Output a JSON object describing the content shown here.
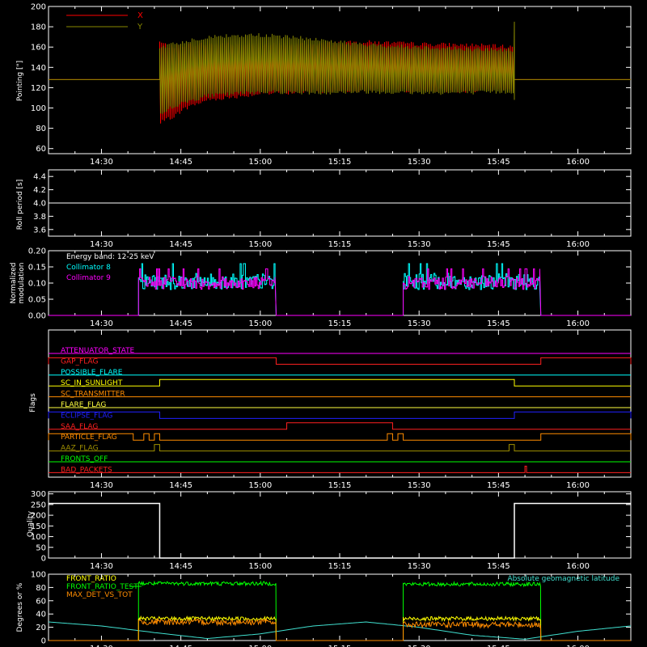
{
  "colors": {
    "background": "#000000",
    "axes": "#ffffff",
    "x_pointing": "#ff0000",
    "y_pointing": "#8a8a00",
    "roll": "#ffffff",
    "collimator8": "#00ffff",
    "collimator9": "#ff00ff",
    "quality": "#ffffff",
    "front_ratio": "#ffff00",
    "front_ratio_test": "#00ff00",
    "max_det": "#ff8c00",
    "geo_lat": "#40e0d0"
  },
  "time_axis": {
    "start_min": 20,
    "end_min": 85,
    "tick_labels": [
      "14:30",
      "14:45",
      "15:00",
      "15:15",
      "15:30",
      "15:45",
      "16:00"
    ],
    "tick_minutes": [
      30,
      45,
      60,
      75,
      90,
      105,
      120
    ],
    "tick_offset_min": [
      25,
      40,
      55,
      70,
      85,
      100,
      115
    ]
  },
  "chart_data": [
    {
      "id": "pointing",
      "type": "line",
      "ylabel": "Pointing [\"]",
      "ylim": [
        55,
        200
      ],
      "yticks": [
        60,
        80,
        100,
        120,
        140,
        160,
        180,
        200
      ],
      "legend": [
        {
          "name": "X",
          "color": "#ff0000"
        },
        {
          "name": "Y",
          "color": "#8a8a00"
        }
      ],
      "series": [
        {
          "name": "X",
          "color": "#ff0000",
          "baseline": 128,
          "active_start": "14:41",
          "active_end": "15:48",
          "env_time": [
            "14:41",
            "14:43",
            "14:46",
            "14:50",
            "15:00",
            "15:10",
            "15:20",
            "15:30",
            "15:40",
            "15:48"
          ],
          "env_low": [
            85,
            90,
            100,
            108,
            114,
            116,
            118,
            117,
            117,
            118
          ],
          "env_high": [
            165,
            160,
            162,
            163,
            162,
            163,
            165,
            163,
            162,
            160
          ]
        },
        {
          "name": "Y",
          "color": "#8a8a00",
          "baseline": 128,
          "active_start": "14:41",
          "active_end": "15:48",
          "env_time": [
            "14:41",
            "14:43",
            "14:46",
            "14:50",
            "15:00",
            "15:10",
            "15:20",
            "15:30",
            "15:40",
            "15:48"
          ],
          "env_low": [
            94,
            100,
            106,
            112,
            116,
            115,
            116,
            115,
            115,
            116
          ],
          "env_high": [
            160,
            162,
            166,
            170,
            172,
            168,
            162,
            160,
            158,
            157
          ]
        }
      ]
    },
    {
      "id": "roll",
      "type": "line",
      "ylabel": "Roll period [s]",
      "ylim": [
        3.5,
        4.5
      ],
      "yticks": [
        3.6,
        3.8,
        4.0,
        4.2,
        4.4
      ],
      "series": [
        {
          "name": "Roll period",
          "constant": 4.0
        }
      ]
    },
    {
      "id": "modulation",
      "type": "line",
      "ylabel": "Normalized modulation",
      "ylim": [
        0,
        0.2
      ],
      "yticks": [
        0.0,
        0.05,
        0.1,
        0.15,
        0.2
      ],
      "ytick_labels": [
        "0.00",
        "0.05",
        "0.10",
        "0.15",
        "0.20"
      ],
      "annotation": "Energy band: 12-25 keV",
      "legend": [
        {
          "name": "Collimator 8",
          "color": "#00ffff"
        },
        {
          "name": "Collimator 9",
          "color": "#ff00ff"
        }
      ],
      "segments": [
        [
          "14:37",
          "15:03"
        ],
        [
          "15:27",
          "15:53"
        ]
      ],
      "series": [
        {
          "name": "Collimator 8",
          "color": "#00ffff",
          "mean": 0.105,
          "spread": 0.025
        },
        {
          "name": "Collimator 9",
          "color": "#ff00ff",
          "mean": 0.1,
          "spread": 0.02
        }
      ]
    },
    {
      "id": "flags",
      "type": "step",
      "ylabel": "Flags",
      "flags": [
        {
          "name": "ATTENUATOR_STATE",
          "color": "#ff00ff",
          "high_intervals": []
        },
        {
          "name": "GAP_FLAG",
          "color": "#ff2020",
          "high_intervals": [
            [
              "14:20",
              "15:03"
            ],
            [
              "15:53",
              "16:10"
            ]
          ]
        },
        {
          "name": "POSSIBLE_FLARE",
          "color": "#00ffff",
          "high_intervals": []
        },
        {
          "name": "SC_IN_SUNLIGHT",
          "color": "#ffff00",
          "high_intervals": [
            [
              "14:41",
              "15:48"
            ]
          ]
        },
        {
          "name": "SC_TRANSMITTER",
          "color": "#ff8c00",
          "high_intervals": []
        },
        {
          "name": "FLARE_FLAG",
          "color": "#ffff40",
          "high_intervals": []
        },
        {
          "name": "ECLIPSE_FLAG",
          "color": "#2020ff",
          "high_intervals": [
            [
              "14:20",
              "14:41"
            ],
            [
              "15:48",
              "16:10"
            ]
          ]
        },
        {
          "name": "SAA_FLAG",
          "color": "#ff2020",
          "high_intervals": [
            [
              "15:05",
              "15:25"
            ]
          ]
        },
        {
          "name": "PARTICLE_FLAG",
          "color": "#ff8c00",
          "high_intervals": [
            [
              "14:20",
              "14:36"
            ],
            [
              "14:38",
              "14:39"
            ],
            [
              "14:40",
              "14:41"
            ],
            [
              "15:24",
              "15:25"
            ],
            [
              "15:26",
              "15:27"
            ],
            [
              "15:53",
              "16:10"
            ]
          ]
        },
        {
          "name": "AAZ_FLAG",
          "color": "#a09000",
          "high_intervals": [
            [
              "14:40",
              "14:41"
            ],
            [
              "15:47",
              "15:48"
            ]
          ]
        },
        {
          "name": "FRONTS_OFF",
          "color": "#00ff00",
          "high_intervals": []
        },
        {
          "name": "BAD_PACKETS",
          "color": "#ff2020",
          "high_intervals": [
            [
              "15:50",
              "15:50"
            ]
          ]
        }
      ]
    },
    {
      "id": "quality",
      "type": "line",
      "ylabel": "Quality",
      "ylim": [
        0,
        310
      ],
      "yticks": [
        0,
        50,
        100,
        150,
        200,
        250,
        300
      ],
      "series": [
        {
          "name": "Quality",
          "color": "#ffffff",
          "high_value": 255,
          "high_intervals": [
            [
              "14:20",
              "14:41"
            ],
            [
              "15:48",
              "16:10"
            ]
          ],
          "low_value": 0
        }
      ]
    },
    {
      "id": "ratios",
      "type": "line",
      "ylabel": "Degrees or %",
      "ylim": [
        0,
        100
      ],
      "yticks": [
        0,
        20,
        40,
        60,
        80,
        100
      ],
      "legend": [
        {
          "name": "FRONT_RATIO",
          "color": "#ffff00"
        },
        {
          "name": "FRONT_RATIO_TEST",
          "color": "#00ff00"
        },
        {
          "name": "MAX_DET_VS_TOT",
          "color": "#ff8c00"
        }
      ],
      "right_legend": {
        "name": "Absolute geomagnetic latitude",
        "color": "#40e0d0"
      },
      "segments": [
        [
          "14:37",
          "15:03"
        ],
        [
          "15:27",
          "15:53"
        ]
      ],
      "series": [
        {
          "name": "FRONT_RATIO_TEST",
          "color": "#00ff00",
          "segment_means": [
            86,
            85
          ]
        },
        {
          "name": "FRONT_RATIO",
          "color": "#ffff00",
          "segment_means": [
            33,
            33
          ]
        },
        {
          "name": "MAX_DET_VS_TOT",
          "color": "#ff8c00",
          "segment_means": [
            28,
            24
          ]
        }
      ],
      "geo_lat": {
        "time": [
          "14:20",
          "14:30",
          "14:40",
          "14:50",
          "15:00",
          "15:10",
          "15:20",
          "15:30",
          "15:40",
          "15:50",
          "16:00",
          "16:10"
        ],
        "value": [
          28,
          22,
          12,
          3,
          10,
          22,
          28,
          20,
          8,
          2,
          14,
          22
        ]
      }
    }
  ]
}
